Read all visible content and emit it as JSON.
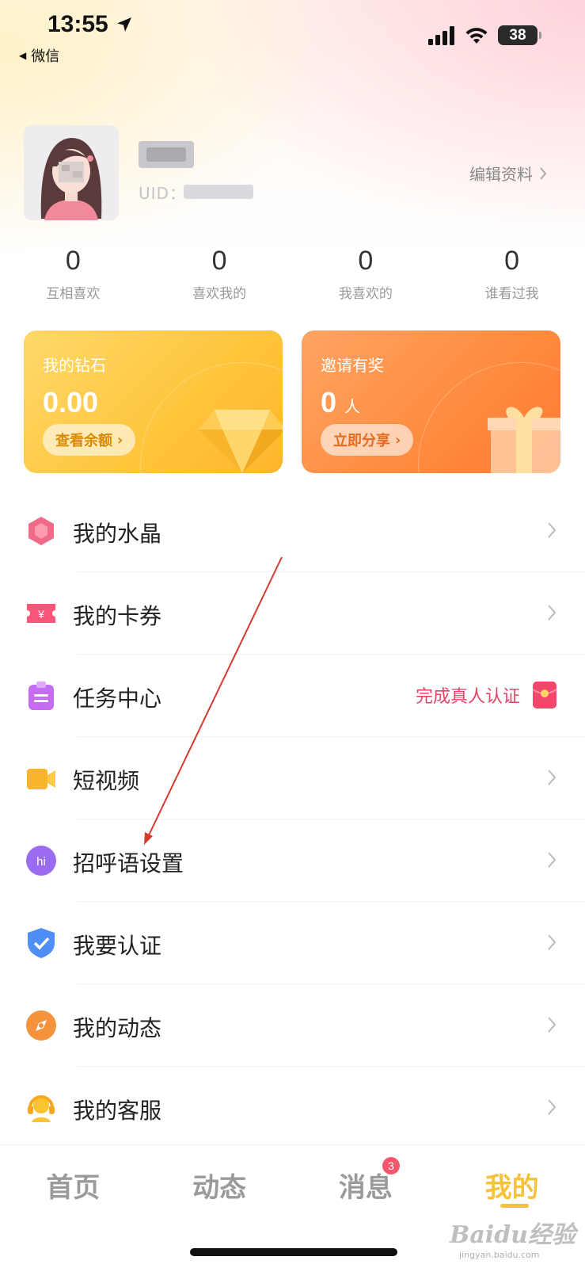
{
  "status_bar": {
    "time": "13:55",
    "back_app": "微信",
    "battery": "38"
  },
  "profile": {
    "uid_label": "UID：",
    "edit_label": "编辑资料"
  },
  "stats": [
    {
      "value": "0",
      "label": "互相喜欢"
    },
    {
      "value": "0",
      "label": "喜欢我的"
    },
    {
      "value": "0",
      "label": "我喜欢的"
    },
    {
      "value": "0",
      "label": "谁看过我"
    }
  ],
  "cards": {
    "diamond": {
      "title": "我的钻石",
      "value": "0.00",
      "button": "查看余额"
    },
    "invite": {
      "title": "邀请有奖",
      "value": "0",
      "unit": "人",
      "button": "立即分享"
    }
  },
  "menu": [
    {
      "label": "我的水晶",
      "icon": "crystal-icon"
    },
    {
      "label": "我的卡券",
      "icon": "coupon-icon"
    },
    {
      "label": "任务中心",
      "icon": "task-icon",
      "extra": "完成真人认证"
    },
    {
      "label": "短视频",
      "icon": "video-camera-icon"
    },
    {
      "label": "招呼语设置",
      "icon": "hi-greeting-icon"
    },
    {
      "label": "我要认证",
      "icon": "shield-check-icon"
    },
    {
      "label": "我的动态",
      "icon": "compass-icon"
    },
    {
      "label": "我的客服",
      "icon": "headset-icon"
    }
  ],
  "bottom_nav": {
    "tabs": [
      "首页",
      "动态",
      "消息",
      "我的"
    ],
    "active_index": 3,
    "message_badge": "3"
  },
  "watermark": {
    "main": "Baidu经验",
    "sub": "jingyan.baidu.com"
  },
  "colors": {
    "accent_yellow": "#f6c23a",
    "accent_red": "#e64464",
    "diamond_card": "#ffc53c",
    "invite_card": "#ff8b3e"
  }
}
